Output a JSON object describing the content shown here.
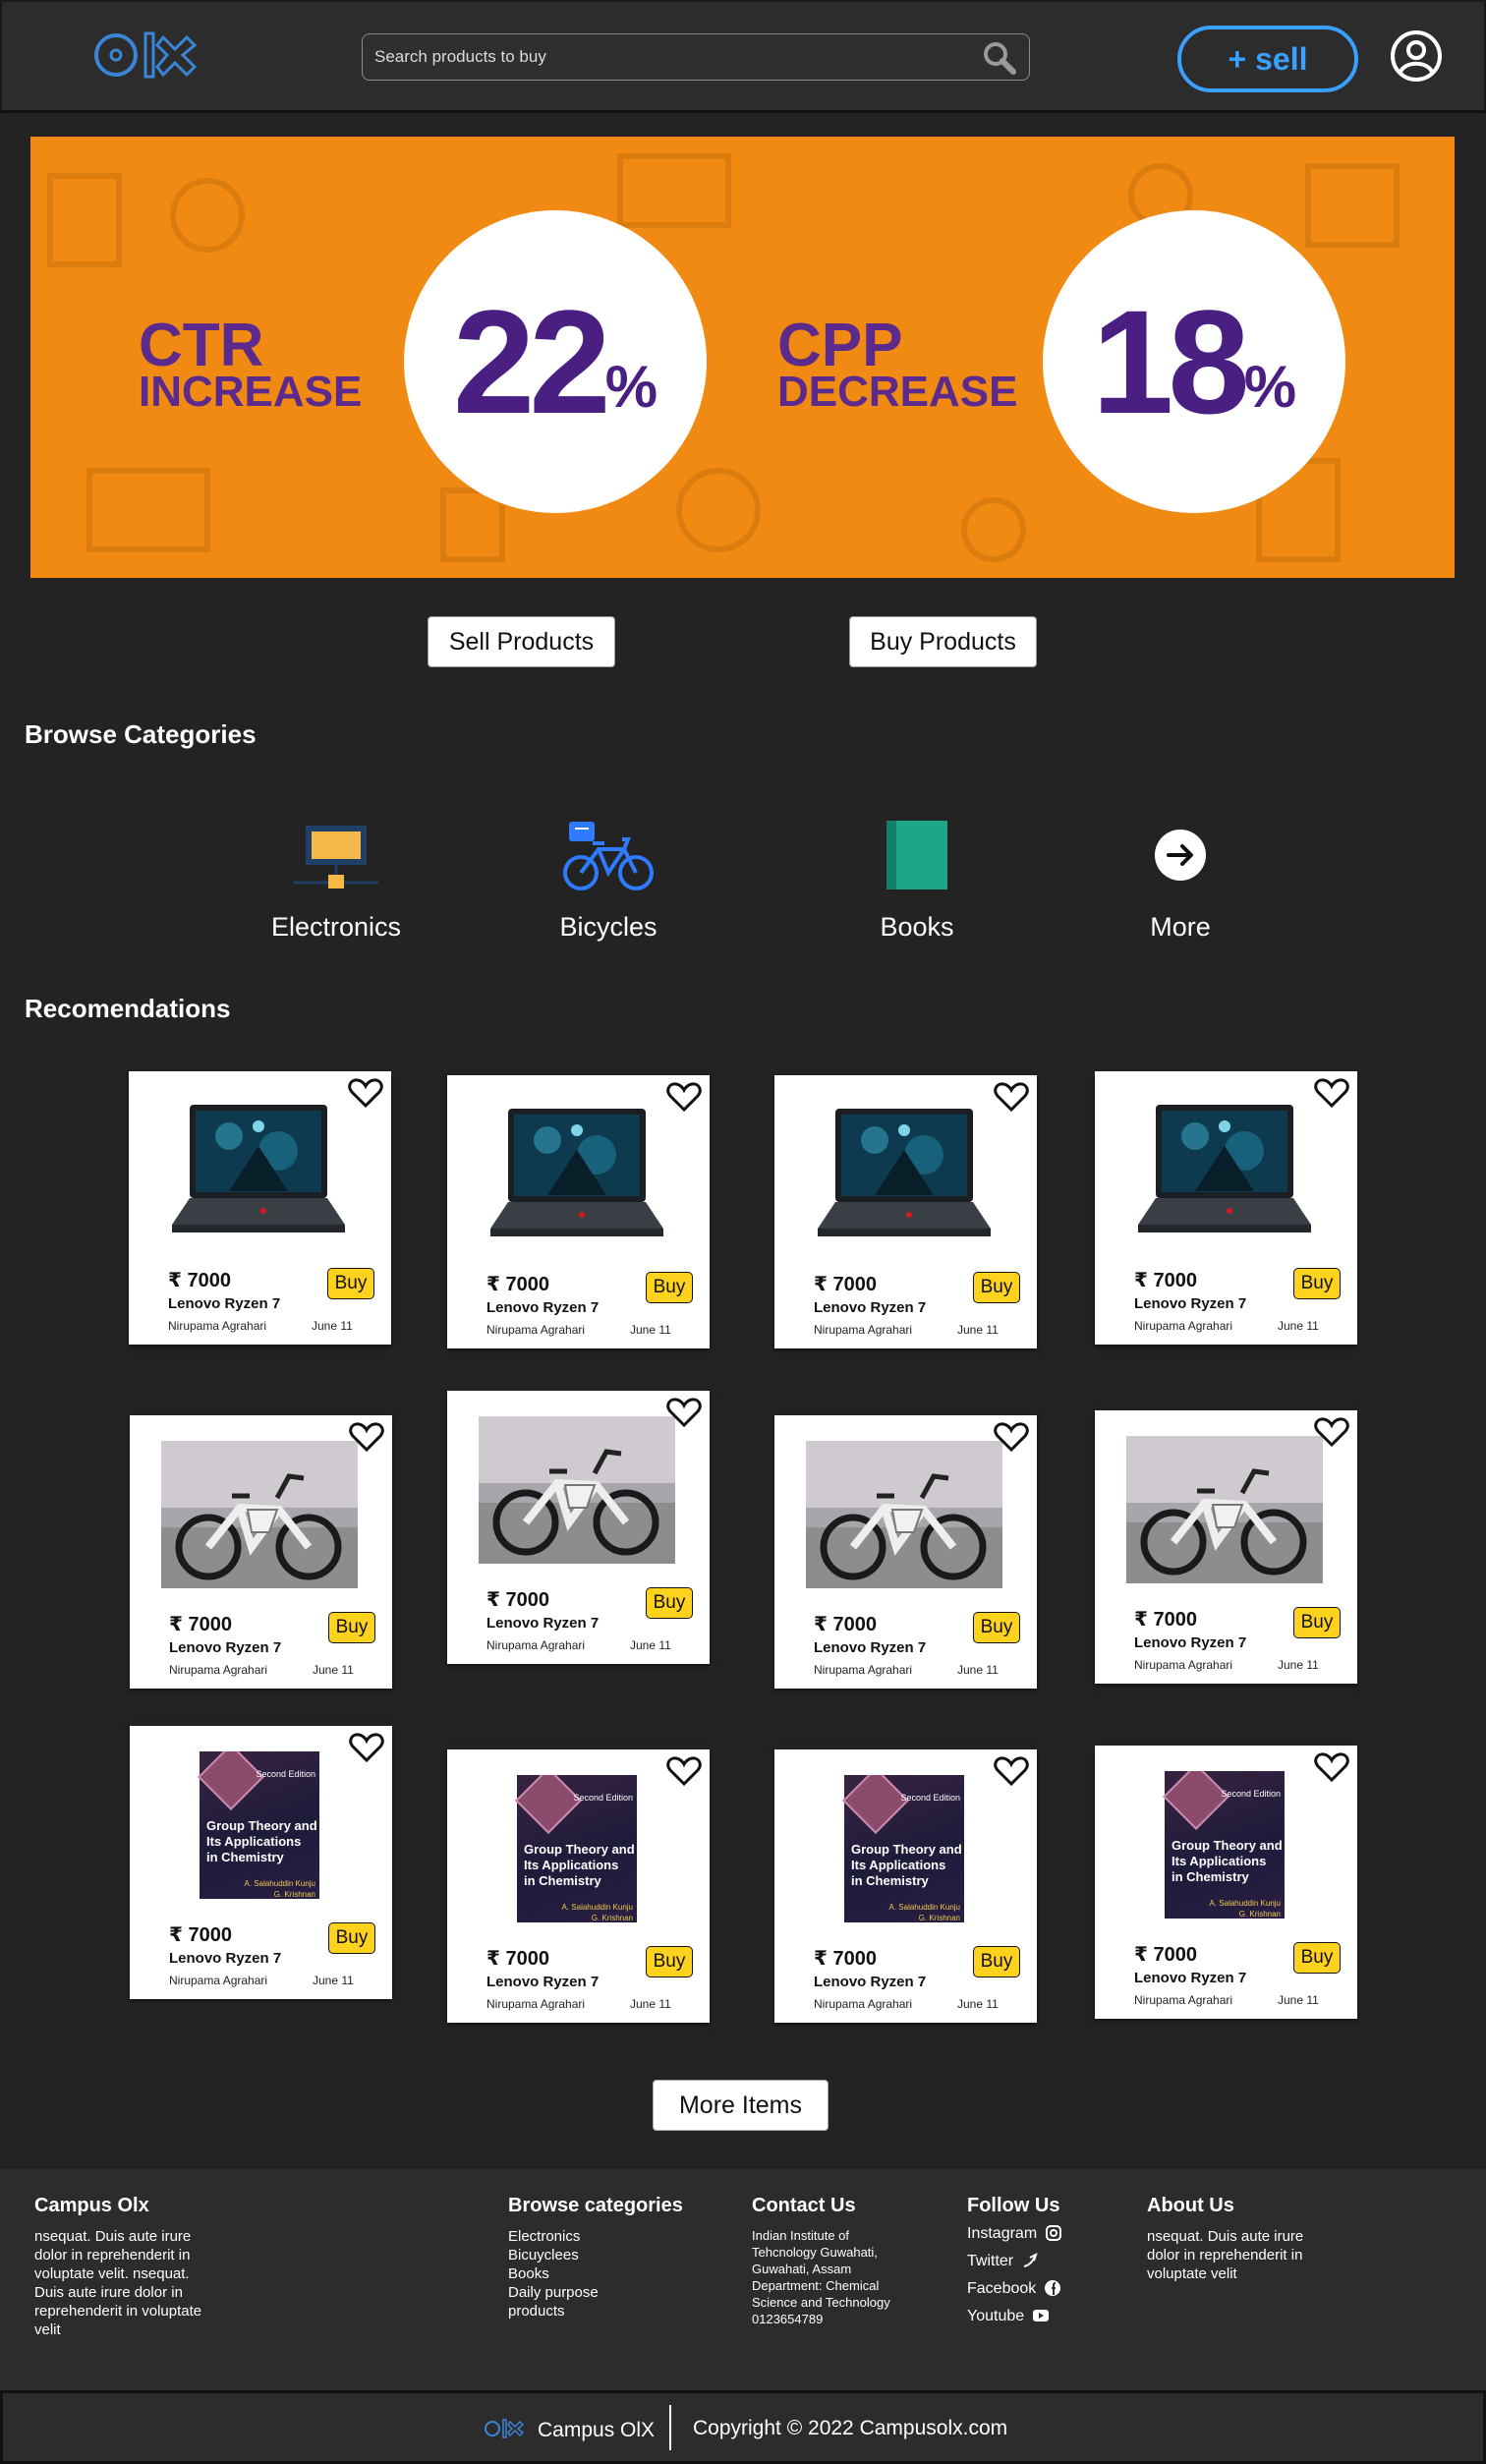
{
  "header": {
    "logo": "olx-logo",
    "search_placeholder": "Search products to buy",
    "sell_label": "+ sell",
    "colors": {
      "accent": "#3aa0ff",
      "background": "#2c2c2c"
    }
  },
  "banner": {
    "left_label_1": "CTR",
    "left_label_2": "INCREASE",
    "left_value": "22",
    "left_unit": "%",
    "right_label_1": "CPP",
    "right_label_2": "DECREASE",
    "right_value": "18",
    "right_unit": "%",
    "colors": {
      "background": "#f08a12",
      "text": "#4a1f82"
    }
  },
  "actions": {
    "sell_label": "Sell Products",
    "buy_label": "Buy Products"
  },
  "categories": {
    "title": "Browse Categories",
    "items": [
      {
        "label": "Electronics",
        "icon": "laptop-icon"
      },
      {
        "label": "Bicycles",
        "icon": "bicycle-icon"
      },
      {
        "label": "Books",
        "icon": "book-icon"
      },
      {
        "label": "More",
        "icon": "arrow-right-icon"
      }
    ]
  },
  "recommendations": {
    "title": "Recomendations",
    "products": [
      {
        "image": "laptop",
        "price": "₹ 7000",
        "title": "Lenovo Ryzen 7",
        "seller": "Nirupama Agrahari",
        "date": "June 11",
        "buy": "Buy"
      },
      {
        "image": "laptop",
        "price": "₹ 7000",
        "title": "Lenovo Ryzen 7",
        "seller": "Nirupama Agrahari",
        "date": "June 11",
        "buy": "Buy"
      },
      {
        "image": "laptop",
        "price": "₹ 7000",
        "title": "Lenovo Ryzen 7",
        "seller": "Nirupama Agrahari",
        "date": "June 11",
        "buy": "Buy"
      },
      {
        "image": "laptop",
        "price": "₹ 7000",
        "title": "Lenovo Ryzen 7",
        "seller": "Nirupama Agrahari",
        "date": "June 11",
        "buy": "Buy"
      },
      {
        "image": "bicycle",
        "price": "₹ 7000",
        "title": "Lenovo Ryzen 7",
        "seller": "Nirupama Agrahari",
        "date": "June 11",
        "buy": "Buy"
      },
      {
        "image": "bicycle",
        "price": "₹ 7000",
        "title": "Lenovo Ryzen 7",
        "seller": "Nirupama Agrahari",
        "date": "June 11",
        "buy": "Buy"
      },
      {
        "image": "bicycle",
        "price": "₹ 7000",
        "title": "Lenovo Ryzen 7",
        "seller": "Nirupama Agrahari",
        "date": "June 11",
        "buy": "Buy"
      },
      {
        "image": "bicycle",
        "price": "₹ 7000",
        "title": "Lenovo Ryzen 7",
        "seller": "Nirupama Agrahari",
        "date": "June 11",
        "buy": "Buy"
      },
      {
        "image": "book",
        "price": "₹ 7000",
        "title": "Lenovo Ryzen 7",
        "seller": "Nirupama Agrahari",
        "date": "June 11",
        "buy": "Buy"
      },
      {
        "image": "book",
        "price": "₹ 7000",
        "title": "Lenovo Ryzen 7",
        "seller": "Nirupama Agrahari",
        "date": "June 11",
        "buy": "Buy"
      },
      {
        "image": "book",
        "price": "₹ 7000",
        "title": "Lenovo Ryzen 7",
        "seller": "Nirupama Agrahari",
        "date": "June 11",
        "buy": "Buy"
      },
      {
        "image": "book",
        "price": "₹ 7000",
        "title": "Lenovo Ryzen 7",
        "seller": "Nirupama Agrahari",
        "date": "June 11",
        "buy": "Buy"
      }
    ],
    "book_cover": {
      "edition": "Second Edition",
      "title_1": "Group Theory and",
      "title_2": "Its Applications",
      "title_3": "in Chemistry",
      "authors_1": "A. Salahuddin Kunju",
      "authors_2": "G. Krishnan"
    },
    "more_label": "More Items"
  },
  "footer": {
    "about": {
      "title": "Campus Olx",
      "text": "nsequat. Duis aute irure dolor in reprehenderit in voluptate velit. nsequat. Duis aute irure dolor in reprehenderit in voluptate velit"
    },
    "browse": {
      "title": "Browse categories",
      "items": [
        "Electronics",
        "Bicuyclees",
        "Books",
        "Daily purpose products"
      ]
    },
    "contact": {
      "title": "Contact Us",
      "address": "Indian Institute of Tehcnology Guwahati, Guwahati, Assam",
      "department": "Department: Chemical Science and Technology",
      "phone": "0123654789"
    },
    "follow": {
      "title": "Follow Us",
      "items": [
        {
          "label": "Instagram",
          "icon": "instagram-icon"
        },
        {
          "label": "Twitter",
          "icon": "twitter-icon"
        },
        {
          "label": "Facebook",
          "icon": "facebook-icon"
        },
        {
          "label": "Youtube",
          "icon": "youtube-icon"
        }
      ]
    },
    "about_us": {
      "title": "About Us",
      "text": "nsequat. Duis aute irure dolor in reprehenderit in voluptate velit"
    }
  },
  "bottombar": {
    "name": "Campus OlX",
    "copyright": "Copyright © 2022 Campusolx.com"
  }
}
